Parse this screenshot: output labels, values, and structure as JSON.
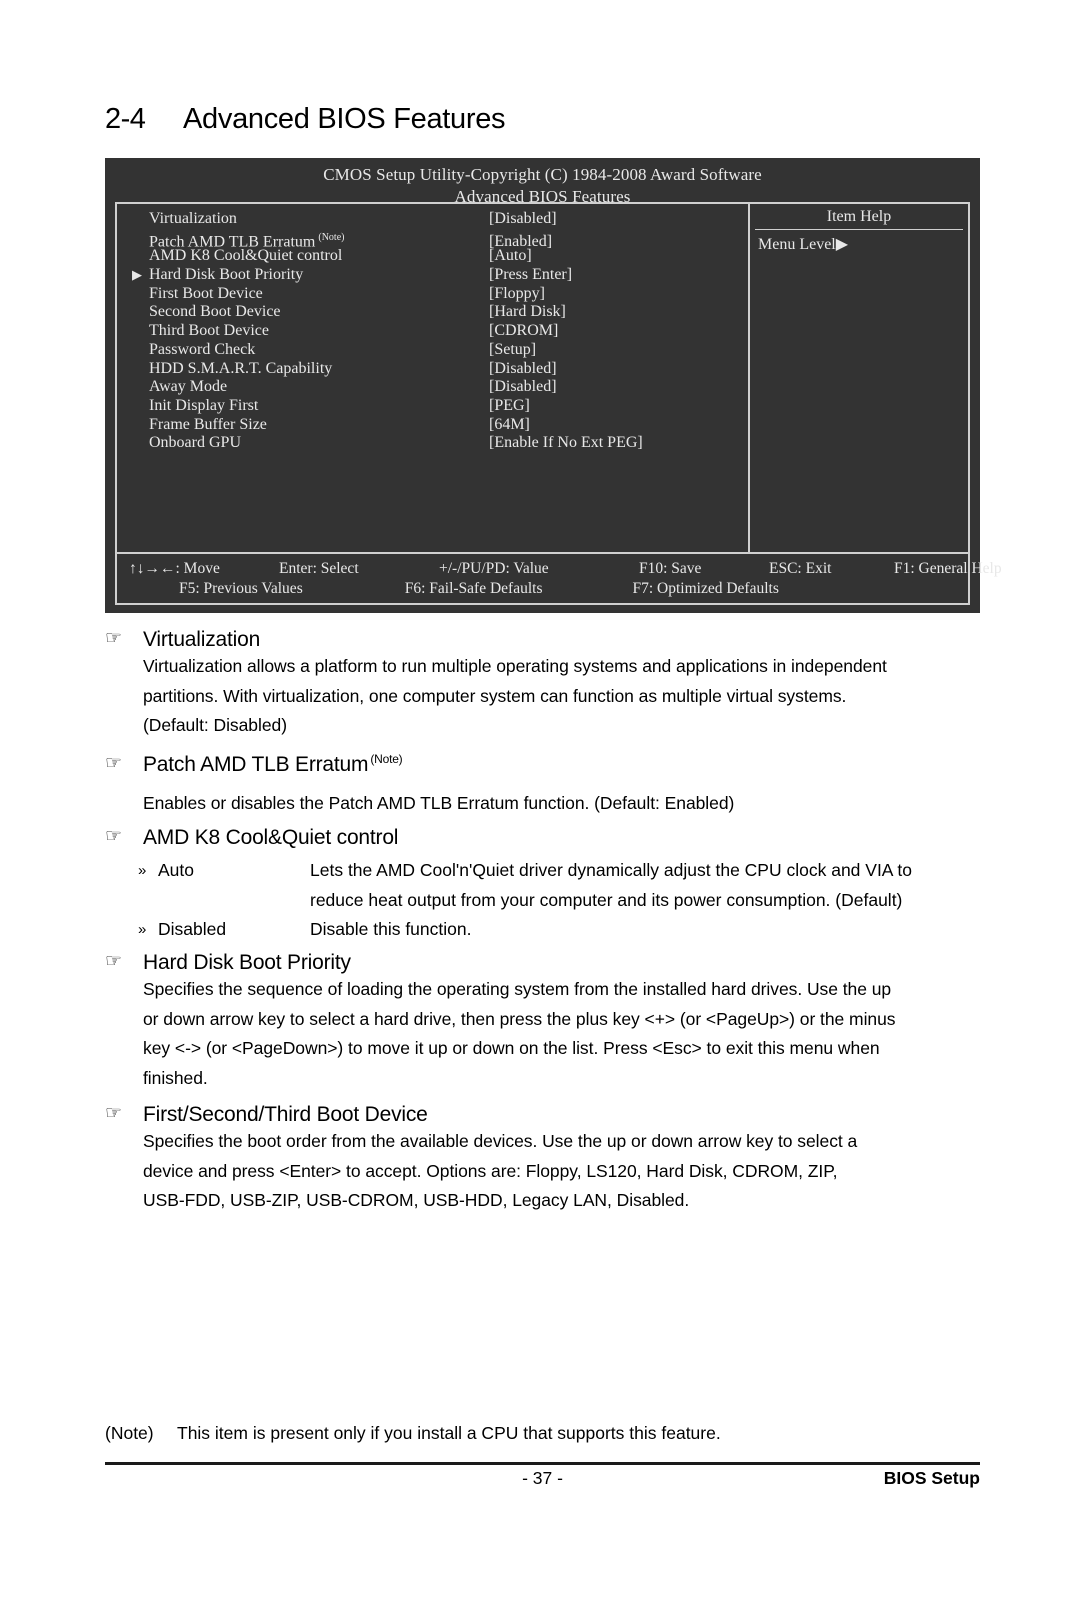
{
  "heading": {
    "number": "2-4",
    "title": "Advanced BIOS Features"
  },
  "bios": {
    "title_line1": "CMOS Setup Utility-Copyright (C) 1984-2008 Award Software",
    "title_line2": "Advanced BIOS Features",
    "items": [
      {
        "arrow": "",
        "label": "Virtualization",
        "note": "",
        "value": "[Disabled]"
      },
      {
        "arrow": "",
        "label": "Patch AMD TLB Erratum",
        "note": "(Note)",
        "value": "[Enabled]"
      },
      {
        "arrow": "",
        "label": "AMD K8 Cool&Quiet control",
        "note": "",
        "value": "[Auto]"
      },
      {
        "arrow": "▶",
        "label": "Hard Disk Boot Priority",
        "note": "",
        "value": "[Press Enter]"
      },
      {
        "arrow": "",
        "label": "First Boot Device",
        "note": "",
        "value": "[Floppy]"
      },
      {
        "arrow": "",
        "label": "Second Boot Device",
        "note": "",
        "value": "[Hard Disk]"
      },
      {
        "arrow": "",
        "label": "Third Boot Device",
        "note": "",
        "value": "[CDROM]"
      },
      {
        "arrow": "",
        "label": "Password Check",
        "note": "",
        "value": "[Setup]"
      },
      {
        "arrow": "",
        "label": "HDD S.M.A.R.T. Capability",
        "note": "",
        "value": "[Disabled]"
      },
      {
        "arrow": "",
        "label": "Away Mode",
        "note": "",
        "value": "[Disabled]"
      },
      {
        "arrow": "",
        "label": "Init Display First",
        "note": "",
        "value": "[PEG]"
      },
      {
        "arrow": "",
        "label": "Frame Buffer Size",
        "note": "",
        "value": "[64M]"
      },
      {
        "arrow": "",
        "label": "Onboard GPU",
        "note": "",
        "value": "[Enable If No Ext PEG]"
      }
    ],
    "help": {
      "title": "Item Help",
      "menu_level": "Menu Level▶"
    },
    "keys_row1": [
      "↑↓→←: Move",
      "Enter: Select",
      "+/-/PU/PD: Value",
      "F10: Save",
      "ESC: Exit",
      "F1: General Help"
    ],
    "keys_row2": [
      "F5: Previous Values",
      "F6: Fail-Safe Defaults",
      "F7: Optimized Defaults"
    ]
  },
  "sections": {
    "virtualization": {
      "bullet": "☞",
      "heading": "Virtualization",
      "paragraph_lines": [
        "Virtualization allows a platform to run multiple operating systems and applications in independent",
        "partitions. With virtualization, one computer system can function as multiple virtual systems.",
        "(Default: Disabled)"
      ]
    },
    "patch_tlb": {
      "bullet": "☞",
      "heading": "Patch AMD TLB Erratum",
      "note": "(Note)",
      "paragraph_lines": [
        "Enables or disables the Patch AMD TLB Erratum function. (Default: Enabled)"
      ]
    },
    "coolquiet": {
      "bullet": "☞",
      "heading": "AMD K8 Cool&Quiet control",
      "options": [
        {
          "bullet": "»",
          "name": "Auto",
          "desc_line1": "Lets the AMD Cool'n'Quiet driver dynamically adjust the CPU clock and VIA to",
          "desc_line2": "reduce heat output from your computer and its power consumption. (Default)"
        },
        {
          "bullet": "»",
          "name": "Disabled",
          "desc_line1": "Disable this function.",
          "desc_line2": ""
        }
      ]
    },
    "hdd_priority": {
      "bullet": "☞",
      "heading": "Hard Disk Boot Priority",
      "paragraph_lines": [
        "Specifies the sequence of loading the operating system from the installed hard drives.  Use the up",
        "or down arrow key to select a hard drive, then press the plus key <+> (or <PageUp>) or the minus",
        "key <-> (or <PageDown>) to move it up or down on the list. Press <Esc> to exit this menu when",
        "finished."
      ]
    },
    "boot_device": {
      "bullet": "☞",
      "heading": "First/Second/Third Boot Device",
      "paragraph_lines": [
        "Specifies the boot order from the available devices. Use the up or down arrow key to select a",
        "device and press <Enter> to accept. Options are: Floppy, LS120, Hard Disk, CDROM, ZIP,",
        "USB-FDD, USB-ZIP, USB-CDROM, USB-HDD, Legacy LAN, Disabled."
      ]
    }
  },
  "footnote": {
    "tag": "(Note)",
    "text": "This item is present only if you install a CPU that supports this feature."
  },
  "footer": {
    "page_number": "- 37 -",
    "right_label": "BIOS Setup"
  }
}
